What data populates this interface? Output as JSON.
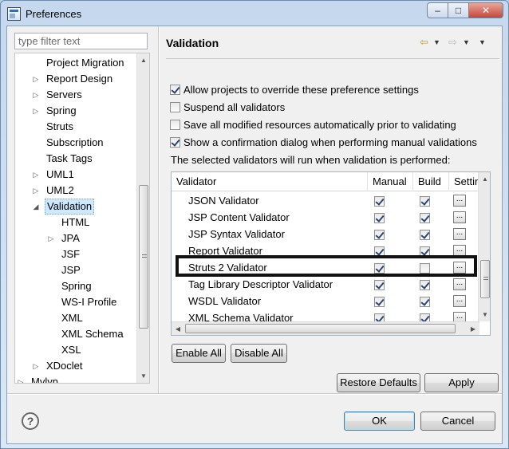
{
  "window": {
    "title": "Preferences"
  },
  "window_controls": {
    "minimize": "–",
    "maximize": "□",
    "close": "✕"
  },
  "filter": {
    "placeholder": "type filter text",
    "value": ""
  },
  "tree": {
    "items": [
      {
        "label": "Project Migration",
        "level": 2,
        "expander": ""
      },
      {
        "label": "Report Design",
        "level": 2,
        "expander": "collapsed"
      },
      {
        "label": "Servers",
        "level": 2,
        "expander": "collapsed"
      },
      {
        "label": "Spring",
        "level": 2,
        "expander": "collapsed"
      },
      {
        "label": "Struts",
        "level": 2,
        "expander": ""
      },
      {
        "label": "Subscription",
        "level": 2,
        "expander": ""
      },
      {
        "label": "Task Tags",
        "level": 2,
        "expander": ""
      },
      {
        "label": "UML1",
        "level": 2,
        "expander": "collapsed"
      },
      {
        "label": "UML2",
        "level": 2,
        "expander": "collapsed"
      },
      {
        "label": "Validation",
        "level": 2,
        "expander": "expanded",
        "selected": true
      },
      {
        "label": "HTML",
        "level": 3,
        "expander": ""
      },
      {
        "label": "JPA",
        "level": 3,
        "expander": "collapsed"
      },
      {
        "label": "JSF",
        "level": 3,
        "expander": ""
      },
      {
        "label": "JSP",
        "level": 3,
        "expander": ""
      },
      {
        "label": "Spring",
        "level": 3,
        "expander": ""
      },
      {
        "label": "WS-I Profile",
        "level": 3,
        "expander": ""
      },
      {
        "label": "XML",
        "level": 3,
        "expander": ""
      },
      {
        "label": "XML Schema",
        "level": 3,
        "expander": ""
      },
      {
        "label": "XSL",
        "level": 3,
        "expander": ""
      },
      {
        "label": "XDoclet",
        "level": 2,
        "expander": "collapsed"
      },
      {
        "label": "Mylyn",
        "level": 1,
        "expander": "collapsed"
      }
    ]
  },
  "page": {
    "title": "Validation"
  },
  "options": [
    {
      "label": "Allow projects to override these preference settings",
      "checked": true
    },
    {
      "label": "Suspend all validators",
      "checked": false
    },
    {
      "label": "Save all modified resources automatically prior to validating",
      "checked": false
    },
    {
      "label": "Show a confirmation dialog when performing manual validations",
      "checked": true
    }
  ],
  "validators_caption": "The selected validators will run when validation is performed:",
  "table": {
    "columns": [
      "Validator",
      "Manual",
      "Build",
      "Settings"
    ],
    "rows": [
      {
        "name": "JSON Validator",
        "manual": true,
        "build": true
      },
      {
        "name": "JSP Content Validator",
        "manual": true,
        "build": true
      },
      {
        "name": "JSP Syntax Validator",
        "manual": true,
        "build": true
      },
      {
        "name": "Report Validator",
        "manual": true,
        "build": true
      },
      {
        "name": "Struts 2 Validator",
        "manual": true,
        "build": false
      },
      {
        "name": "Tag Library Descriptor Validator",
        "manual": true,
        "build": true
      },
      {
        "name": "WSDL Validator",
        "manual": true,
        "build": true
      },
      {
        "name": "XML Schema Validator",
        "manual": true,
        "build": true
      }
    ],
    "settings_button": "..."
  },
  "buttons": {
    "enable_all": "Enable All",
    "disable_all": "Disable All",
    "restore_defaults": "Restore Defaults",
    "apply": "Apply",
    "ok": "OK",
    "cancel": "Cancel"
  },
  "help": "?"
}
